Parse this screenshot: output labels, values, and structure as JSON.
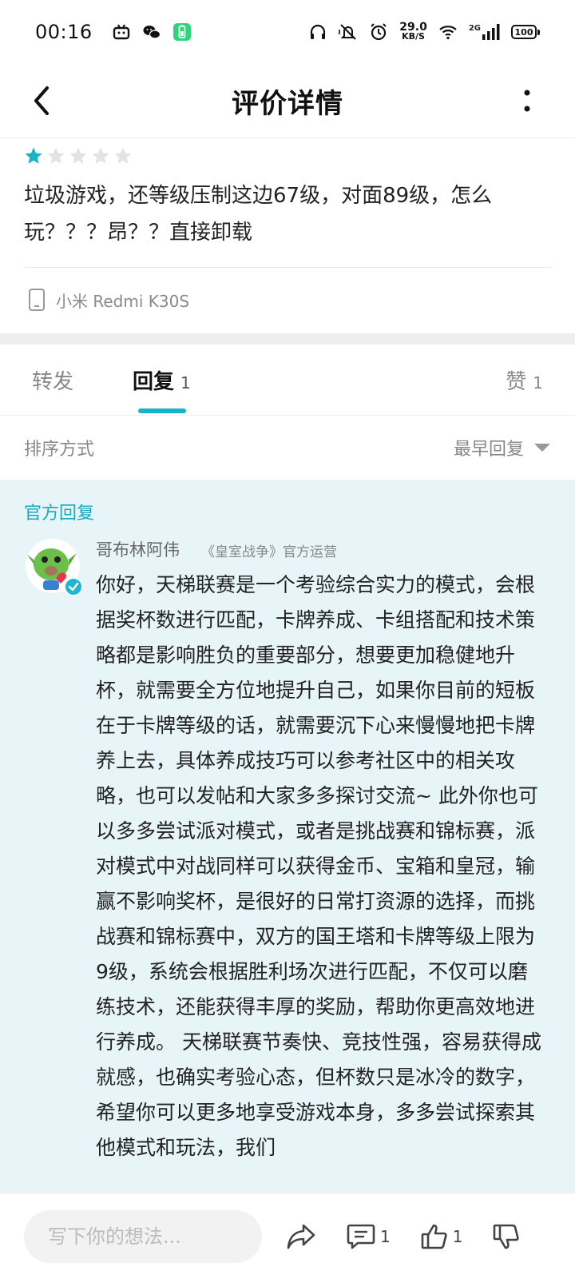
{
  "status_bar": {
    "time": "00:16",
    "net_speed_value": "29.0",
    "net_speed_unit": "KB/S",
    "network_type": "2G",
    "battery": "100",
    "icons": [
      "bilibili-icon",
      "wechat-icon",
      "battery-saver-icon",
      "headphones-icon",
      "mute-vibrate-icon",
      "alarm-icon",
      "wifi-icon",
      "signal-icon"
    ]
  },
  "header": {
    "title": "评价详情",
    "back_icon": "chevron-left-icon",
    "more_icon": "more-vertical-icon"
  },
  "review": {
    "rating": 1,
    "max_rating": 5,
    "text": "垃圾游戏，还等级压制这边67级，对面89级，怎么玩？？？昂？？直接卸载",
    "device": "小米 Redmi K30S",
    "device_icon": "phone-icon"
  },
  "tabs": [
    {
      "label": "转发",
      "count": ""
    },
    {
      "label": "回复",
      "count": "1"
    },
    {
      "label": "赞",
      "count": "1"
    }
  ],
  "sort": {
    "label": "排序方式",
    "value": "最早回复",
    "icon": "triangle-down-icon"
  },
  "official_reply": {
    "section_label": "官方回复",
    "author": "哥布林阿伟",
    "tagline": "《皇室战争》官方运营",
    "avatar_icon": "goblin-avatar-icon",
    "verified_icon": "verified-check-icon",
    "text": "你好，天梯联赛是一个考验综合实力的模式，会根据奖杯数进行匹配，卡牌养成、卡组搭配和技术策略都是影响胜负的重要部分，想要更加稳健地升杯，就需要全方位地提升自己，如果你目前的短板在于卡牌等级的话，就需要沉下心来慢慢地把卡牌养上去，具体养成技巧可以参考社区中的相关攻略，也可以发帖和大家多多探讨交流~ 此外你也可以多多尝试派对模式，或者是挑战赛和锦标赛，派对模式中对战同样可以获得金币、宝箱和皇冠，输赢不影响奖杯，是很好的日常打资源的选择，而挑战赛和锦标赛中，双方的国王塔和卡牌等级上限为9级，系统会根据胜利场次进行匹配，不仅可以磨练技术，还能获得丰厚的奖励，帮助你更高效地进行养成。 天梯联赛节奏快、竞技性强，容易获得成就感，也确实考验心态，但杯数只是冰冷的数字，希望你可以更多地享受游戏本身，多多尝试探索其他模式和玩法，我们"
  },
  "bottom_bar": {
    "input_placeholder": "写下你的想法...",
    "share_icon": "share-icon",
    "comment_icon": "comment-icon",
    "comment_count": "1",
    "like_icon": "thumbs-up-icon",
    "like_count": "1",
    "dislike_icon": "thumbs-down-icon"
  },
  "colors": {
    "accent": "#17b3c8",
    "star_active": "#17b3c8",
    "star_inactive": "#e3e3e3",
    "official_bg": "#e7f5f8"
  }
}
